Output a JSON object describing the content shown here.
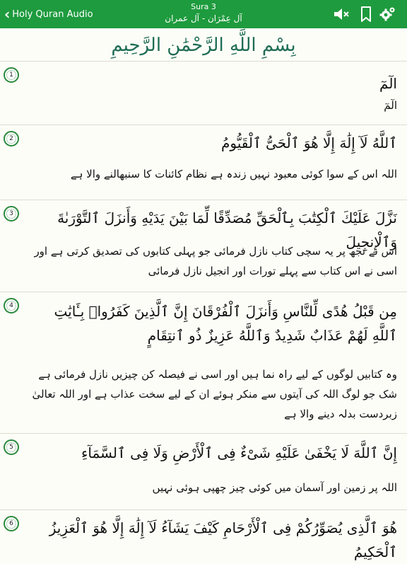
{
  "header": {
    "back_label": "Holy Quran Audio",
    "sura_label": "Sura 3",
    "sura_name": "آل عِمْرَان - آل عمران",
    "icons": [
      "mute-speaker-icon",
      "bookmark-icon",
      "settings-gear-icon"
    ],
    "bar_color": "#1e9b3e"
  },
  "basmala": "بِسْمِ اللَّهِ الرَّحْمَٰنِ الرَّحِيمِ",
  "verses": [
    {
      "number": "1",
      "arabic": "الٓمٓ",
      "urdu": "الٓمٓ"
    },
    {
      "number": "2",
      "arabic": "ٱللَّهُ لَآ إِلَٰهَ إِلَّا هُوَ ٱلْحَىُّ ٱلْقَيُّومُ",
      "urdu": "اللہ اس کے سوا کوئی معبود نہیں زندہ ہے نظام کائنات کا سنبھالنے والا ہے"
    },
    {
      "number": "3",
      "arabic": "نَزَّلَ عَلَيْكَ ٱلْكِتَٰبَ بِٱلْحَقِّ مُصَدِّقًا لِّمَا بَيْنَ يَدَيْهِ وَأَنزَلَ ٱلتَّوْرَىٰةَ وَٱلْإِنجِيلَ",
      "urdu": "اس نے تجھ پر یہ سچی کتاب نازل فرمائی جو پہلی کتابوں کی تصدیق کرتی ہے اور اسی نے اس کتاب سے پہلے تورات اور انجیل نازل فرمائی"
    },
    {
      "number": "4",
      "arabic": "مِن قَبْلُ هُدًى لِّلنَّاسِ وَأَنزَلَ ٱلْفُرْقَانَ إِنَّ ٱلَّذِينَ كَفَرُوا۟ بِـَٔايَٰتِ ٱللَّهِ لَهُمْ عَذَابٌ شَدِيدٌ وَٱللَّهُ عَزِيزٌ ذُو ٱنتِقَامٍ",
      "urdu": "وہ کتابیں لوگوں کے لیے راہ نما ہیں اور اسی نے فیصلہ کن چیزیں نازل فرمائی ہے شک جو لوگ اللہ کی آیتوں سے منکر ہوئے ان کے لیے سخت عذاب ہے اور اللہ تعالیٰ زبردست بدلہ دینے والا ہے"
    },
    {
      "number": "5",
      "arabic": "إِنَّ ٱللَّهَ لَا يَخْفَىٰ عَلَيْهِ شَىْءٌ فِى ٱلْأَرْضِ وَلَا فِى ٱلسَّمَآءِ",
      "urdu": "اللہ پر زمین اور آسمان میں کوئی چیز چھپی ہوئی نہیں"
    },
    {
      "number": "6",
      "arabic": "هُوَ ٱلَّذِى يُصَوِّرُكُمْ فِى ٱلْأَرْحَامِ كَيْفَ يَشَآءُ لَآ إِلَٰهَ إِلَّا هُوَ ٱلْعَزِيزُ ٱلْحَكِيمُ",
      "urdu": ""
    }
  ]
}
